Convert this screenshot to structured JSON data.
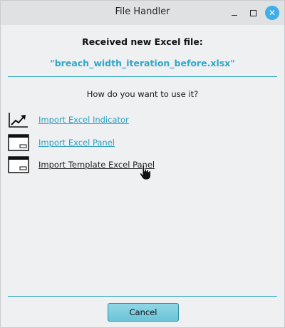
{
  "window": {
    "title": "File Handler"
  },
  "dialog": {
    "heading": "Received new Excel file:",
    "filename": "\"breach_width_iteration_before.xlsx\"",
    "question": "How do you want to use it?",
    "options": [
      {
        "label": "Import Excel Indicator",
        "icon": "trend-chart-icon"
      },
      {
        "label": "Import Excel Panel",
        "icon": "window-panel-icon"
      },
      {
        "label": "Import Template Excel Panel",
        "icon": "window-panel-icon"
      }
    ],
    "cancel_label": "Cancel"
  },
  "colors": {
    "accent": "#31a7c9",
    "close_button": "#3daee9",
    "cancel_button": "#7ccbdd"
  }
}
